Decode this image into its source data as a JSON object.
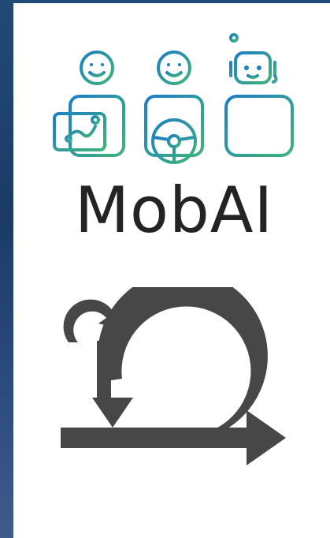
{
  "brand": {
    "name": "MobAI",
    "gradient_start": "#1d7fc4",
    "gradient_end": "#3fb37a",
    "text_color": "#232323"
  },
  "icons": {
    "mob_figures": [
      "navigator-icon",
      "driver-icon",
      "ai-robot-icon"
    ],
    "agile_loop": "scrum-cycle-icon"
  },
  "colors": {
    "background": "#1f3a63",
    "card": "#ffffff",
    "loop_arrow": "#474747"
  }
}
